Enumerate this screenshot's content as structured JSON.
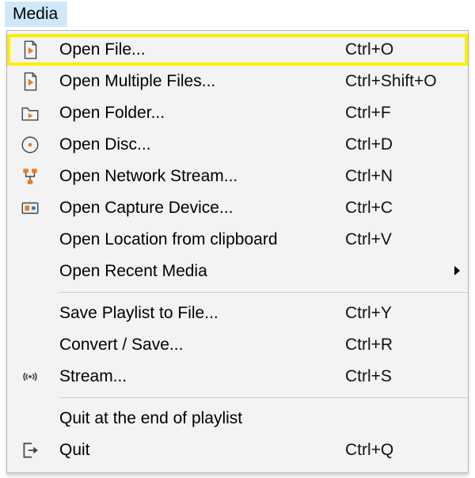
{
  "menubar": {
    "media": "Media"
  },
  "menu": {
    "open_file": {
      "label": "Open File...",
      "shortcut": "Ctrl+O"
    },
    "open_multiple": {
      "label": "Open Multiple Files...",
      "shortcut": "Ctrl+Shift+O"
    },
    "open_folder": {
      "label": "Open Folder...",
      "shortcut": "Ctrl+F"
    },
    "open_disc": {
      "label": "Open Disc...",
      "shortcut": "Ctrl+D"
    },
    "open_network": {
      "label": "Open Network Stream...",
      "shortcut": "Ctrl+N"
    },
    "open_capture": {
      "label": "Open Capture Device...",
      "shortcut": "Ctrl+C"
    },
    "open_clipboard": {
      "label": "Open Location from clipboard",
      "shortcut": "Ctrl+V"
    },
    "open_recent": {
      "label": "Open Recent Media",
      "shortcut": ""
    },
    "save_playlist": {
      "label": "Save Playlist to File...",
      "shortcut": "Ctrl+Y"
    },
    "convert_save": {
      "label": "Convert / Save...",
      "shortcut": "Ctrl+R"
    },
    "stream": {
      "label": "Stream...",
      "shortcut": "Ctrl+S"
    },
    "quit_end_playlist": {
      "label": "Quit at the end of playlist",
      "shortcut": ""
    },
    "quit": {
      "label": "Quit",
      "shortcut": "Ctrl+Q"
    }
  }
}
